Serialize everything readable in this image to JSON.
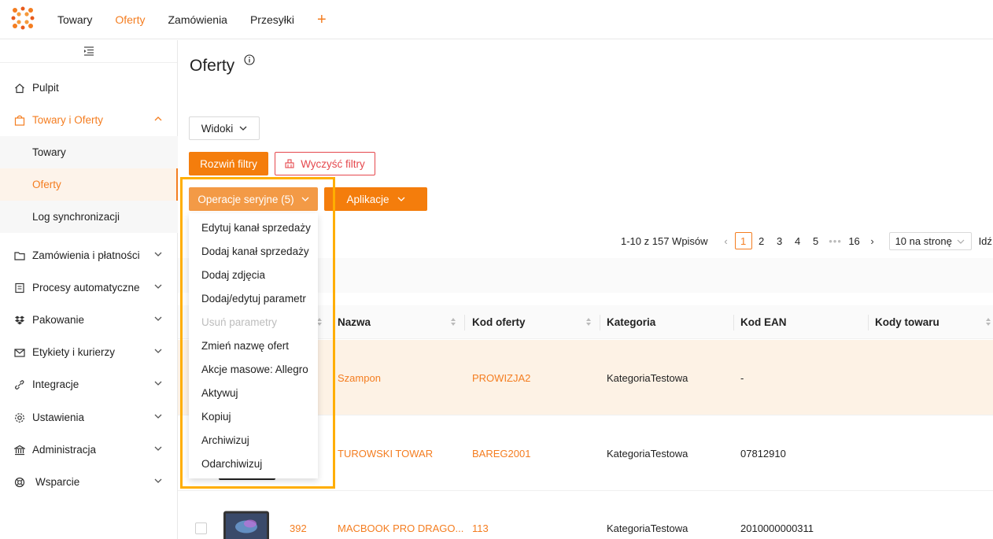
{
  "topnav": {
    "items": [
      {
        "label": "Towary",
        "active": false
      },
      {
        "label": "Oferty",
        "active": true
      },
      {
        "label": "Zamówienia",
        "active": false
      },
      {
        "label": "Przesyłki",
        "active": false
      }
    ],
    "plus": "+"
  },
  "sidebar": {
    "items": {
      "pulpit": "Pulpit",
      "towary_oferty": "Towary i Oferty",
      "towary": "Towary",
      "oferty": "Oferty",
      "log": "Log synchronizacji",
      "zamowienia": "Zamówienia i płatności",
      "procesy": "Procesy automatyczne",
      "pakowanie": "Pakowanie",
      "etykiety": "Etykiety i kurierzy",
      "integracje": "Integracje",
      "ustawienia": "Ustawienia",
      "administracja": "Administracja",
      "wsparcie": "Wsparcie"
    }
  },
  "page": {
    "title": "Oferty",
    "views_button": "Widoki",
    "expand_filters": "Rozwiń filtry",
    "clear_filters": "Wyczyść filtry",
    "bulk_ops": "Operacje seryjne (5)",
    "apps": "Aplikacje"
  },
  "bulk_menu": [
    {
      "label": "Edytuj kanał sprzedaży",
      "disabled": false
    },
    {
      "label": "Dodaj kanał sprzedaży",
      "disabled": false
    },
    {
      "label": "Dodaj zdjęcia",
      "disabled": false
    },
    {
      "label": "Dodaj/edytuj parametr",
      "disabled": false
    },
    {
      "label": "Usuń parametry",
      "disabled": true
    },
    {
      "label": "Zmień nazwę ofert",
      "disabled": false
    },
    {
      "label": "Akcje masowe: Allegro",
      "disabled": false
    },
    {
      "label": "Aktywuj",
      "disabled": false
    },
    {
      "label": "Kopiuj",
      "disabled": false
    },
    {
      "label": "Archiwizuj",
      "disabled": false
    },
    {
      "label": "Odarchiwizuj",
      "disabled": false
    }
  ],
  "pagination": {
    "total": "1-10 z 157 Wpisów",
    "pages": [
      "1",
      "2",
      "3",
      "4",
      "5"
    ],
    "current": "1",
    "last": "16",
    "dots": "•••",
    "page_size": "10 na stronę",
    "goto": "Idź d"
  },
  "table": {
    "headers": {
      "nazwa": "Nazwa",
      "kod": "Kod oferty",
      "kategoria": "Kategoria",
      "ean": "Kod EAN",
      "kody": "Kody towaru"
    },
    "rows": [
      {
        "id": "",
        "nazwa": "Szampon",
        "kod": "PROWIZJA2",
        "kategoria": "KategoriaTestowa",
        "ean": "-"
      },
      {
        "id": "",
        "nazwa": "TUROWSKI TOWAR",
        "kod": "BAREG2001",
        "kategoria": "KategoriaTestowa",
        "ean": "07812910"
      },
      {
        "id": "392",
        "nazwa": "MACBOOK PRO DRAGO...",
        "kod": "113",
        "kategoria": "KategoriaTestowa",
        "ean": "2010000000311"
      }
    ]
  },
  "colors": {
    "accent": "#f47d20",
    "highlight": "#ffae00",
    "danger": "#e5484d"
  }
}
